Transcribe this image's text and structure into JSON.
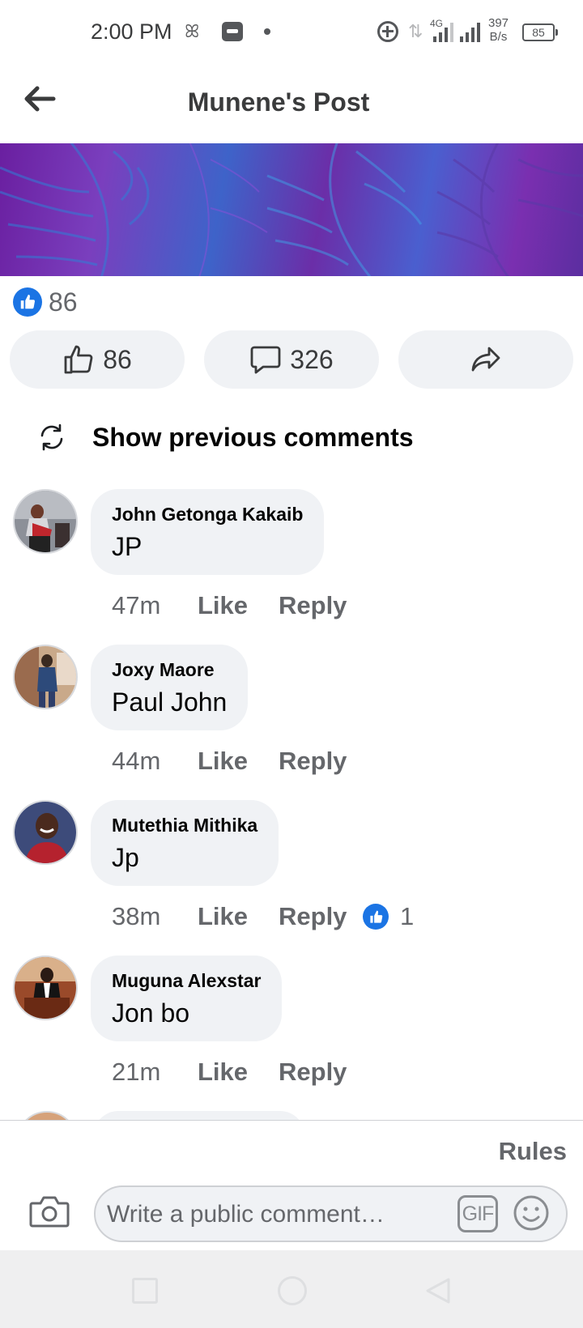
{
  "status_bar": {
    "time": "2:00 PM",
    "network_type": "4G",
    "speed_value": "397",
    "speed_unit": "B/s",
    "battery": "85"
  },
  "header": {
    "title": "Munene's Post",
    "back_icon": "arrow-left-icon"
  },
  "post": {
    "reaction_count": "86",
    "actions": {
      "like_count": "86",
      "comment_count": "326",
      "share_icon": "share-arrow-icon"
    }
  },
  "show_previous_label": "Show previous comments",
  "comments": [
    {
      "author": "John Getonga Kakaib",
      "text": "JP",
      "time": "47m",
      "like_label": "Like",
      "reply_label": "Reply",
      "reactions": ""
    },
    {
      "author": "Joxy Maore",
      "text": "Paul John",
      "time": "44m",
      "like_label": "Like",
      "reply_label": "Reply",
      "reactions": ""
    },
    {
      "author": "Mutethia Mithika",
      "text": "Jp",
      "time": "38m",
      "like_label": "Like",
      "reply_label": "Reply",
      "reactions": "1"
    },
    {
      "author": "Muguna Alexstar",
      "text": "Jon bo",
      "time": "21m",
      "like_label": "Like",
      "reply_label": "Reply",
      "reactions": ""
    }
  ],
  "composer": {
    "rules_label": "Rules",
    "placeholder": "Write a public comment…",
    "gif_label": "GIF"
  },
  "colors": {
    "accent": "#1b74e4",
    "bubble": "#f0f2f5",
    "muted_text": "#65676b"
  }
}
